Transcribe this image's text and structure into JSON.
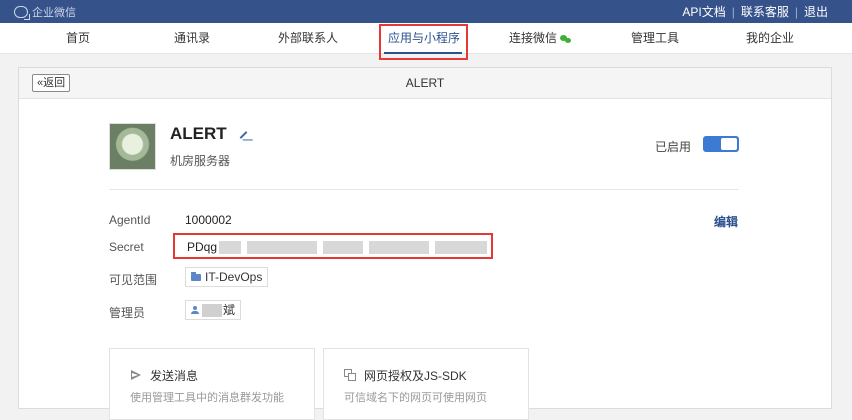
{
  "topbar": {
    "logo_text": "企业微信",
    "links": [
      "API文档",
      "联系客服",
      "退出"
    ]
  },
  "nav": {
    "items": [
      "首页",
      "通讯录",
      "外部联系人",
      "应用与小程序",
      "连接微信",
      "管理工具",
      "我的企业"
    ],
    "active_index": 3
  },
  "panel": {
    "back_label": "返回",
    "title": "ALERT"
  },
  "app": {
    "name": "ALERT",
    "description": "机房服务器",
    "status_label": "已启用",
    "enabled": true
  },
  "fields": {
    "agentid_label": "AgentId",
    "agentid_value": "1000002",
    "secret_label": "Secret",
    "secret_value_visible": "PDqg",
    "visibility_label": "可见范围",
    "visibility_value": "IT-DevOps",
    "admin_label": "管理员",
    "admin_value_visible": "斌",
    "edit_label": "编辑"
  },
  "cards": [
    {
      "title": "发送消息",
      "desc": "使用管理工具中的消息群发功能"
    },
    {
      "title": "网页授权及JS-SDK",
      "desc": "可信域名下的网页可使用网页"
    }
  ],
  "colors": {
    "topbar": "#36528a",
    "accent": "#2b5190",
    "highlight_red": "#e53935",
    "toggle": "#3b7bd4",
    "wechat_green": "#3cb034"
  }
}
